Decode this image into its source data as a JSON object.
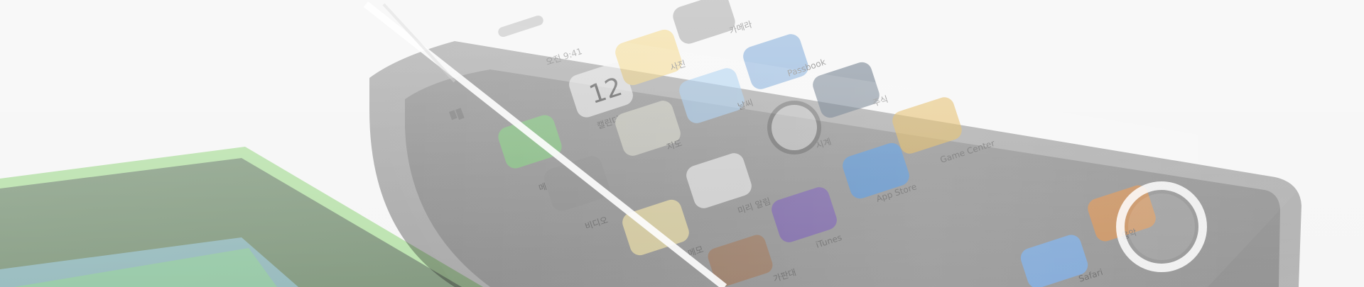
{
  "scene": {
    "phone": {
      "status_time": "오전 9:41",
      "dock_labels": [
        "음악",
        "Safari"
      ],
      "apps": [
        {
          "id": "messages",
          "label": "메시지",
          "icon": "messages-icon",
          "color": "#7ed179"
        },
        {
          "id": "calendar",
          "label": "캘린더",
          "icon": "calendar-icon",
          "color": "#f2f2f2",
          "badge": "12"
        },
        {
          "id": "photos",
          "label": "사진",
          "icon": "photos-icon",
          "color": "#f3d37a"
        },
        {
          "id": "camera",
          "label": "카메라",
          "icon": "camera-icon",
          "color": "#9a9a9a"
        },
        {
          "id": "videos",
          "label": "비디오",
          "icon": "videos-icon",
          "color": "#8a8a8a"
        },
        {
          "id": "maps",
          "label": "지도",
          "icon": "maps-icon",
          "color": "#d5d5c7"
        },
        {
          "id": "weather",
          "label": "날씨",
          "icon": "weather-icon",
          "color": "#9fc9ef"
        },
        {
          "id": "passbook",
          "label": "Passbook",
          "icon": "passbook-icon",
          "color": "#6fa0d5"
        },
        {
          "id": "notes",
          "label": "메모",
          "icon": "notes-icon",
          "color": "#f7e6a1"
        },
        {
          "id": "reminders",
          "label": "미리 알림",
          "icon": "reminders-icon",
          "color": "#efefef"
        },
        {
          "id": "clock",
          "label": "시계",
          "icon": "clock-icon",
          "color": "#2c2c2c"
        },
        {
          "id": "stocks",
          "label": "주식",
          "icon": "stocks-icon",
          "color": "#5b6b7c"
        },
        {
          "id": "newsstand",
          "label": "가판대",
          "icon": "newsstand-icon",
          "color": "#9b6c4a"
        },
        {
          "id": "itunes",
          "label": "iTunes",
          "icon": "itunes-icon",
          "color": "#6c4bb1"
        },
        {
          "id": "appstore",
          "label": "App Store",
          "icon": "appstore-icon",
          "color": "#3d8ee6"
        },
        {
          "id": "gamecenter",
          "label": "Game Center",
          "icon": "gamecenter-icon",
          "color": "#e0b24c"
        }
      ],
      "dock_apps": [
        {
          "id": "music",
          "label": "음악",
          "icon": "music-icon",
          "color": "#e98d3c"
        },
        {
          "id": "safari",
          "label": "Safari",
          "icon": "safari-icon",
          "color": "#6eb1ff"
        }
      ]
    },
    "colors": {
      "background": "#f6f6f6",
      "device_body": "#1b1b1b",
      "screen_glass": "#2b2b2b",
      "tablet_edge": "#8ad173"
    }
  }
}
